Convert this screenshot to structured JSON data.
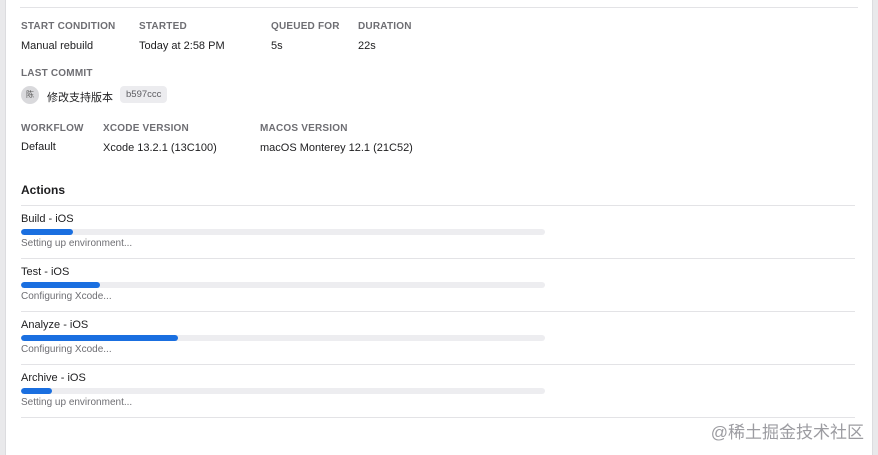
{
  "build_info": {
    "start_condition": {
      "label": "START CONDITION",
      "value": "Manual rebuild"
    },
    "started": {
      "label": "STARTED",
      "value": "Today at 2:58 PM"
    },
    "queued_for": {
      "label": "QUEUED FOR",
      "value": "5s"
    },
    "duration": {
      "label": "DURATION",
      "value": "22s"
    }
  },
  "last_commit": {
    "label": "LAST COMMIT",
    "author_initial": "陈",
    "message": "修改支持版本",
    "sha": "b597ccc"
  },
  "environment": {
    "workflow": {
      "label": "WORKFLOW",
      "value": "Default"
    },
    "xcode_version": {
      "label": "XCODE VERSION",
      "value": "Xcode 13.2.1 (13C100)"
    },
    "macos_version": {
      "label": "MACOS VERSION",
      "value": "macOS Monterey 12.1 (21C52)"
    }
  },
  "actions": {
    "title": "Actions",
    "items": [
      {
        "name": "Build - iOS",
        "status": "Setting up environment...",
        "progress": 0.1
      },
      {
        "name": "Test - iOS",
        "status": "Configuring Xcode...",
        "progress": 0.15
      },
      {
        "name": "Analyze - iOS",
        "status": "Configuring Xcode...",
        "progress": 0.3
      },
      {
        "name": "Archive - iOS",
        "status": "Setting up environment...",
        "progress": 0.06
      }
    ]
  },
  "watermark": "@稀土掘金技术社区",
  "colors": {
    "accent": "#1a6fe0",
    "track": "#ededf0",
    "caption": "#6e6e73"
  }
}
